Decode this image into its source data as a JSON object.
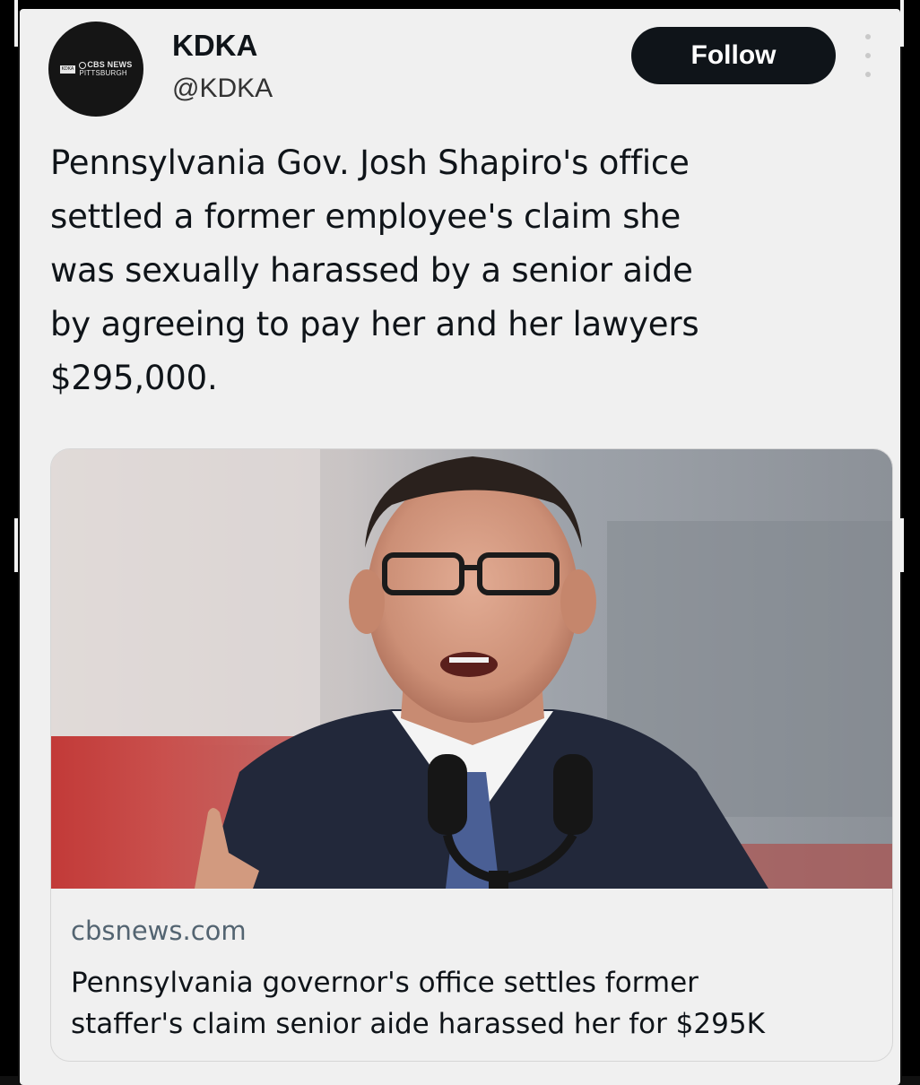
{
  "account": {
    "name": "KDKA",
    "handle": "@KDKA",
    "avatar_logo_box": "KDKA",
    "avatar_logo_line1": "CBS NEWS",
    "avatar_logo_line2": "PITTSBURGH"
  },
  "actions": {
    "follow_label": "Follow",
    "more_icon": "more-vertical-icon"
  },
  "tweet": {
    "text": "Pennsylvania Gov. Josh Shapiro's office\nsettled a former employee's claim she\nwas sexually harassed by a senior aide\nby agreeing to pay her and her lawyers\n$295,000."
  },
  "link_card": {
    "domain": "cbsnews.com",
    "headline": "Pennsylvania governor's office settles former\nstaffer's claim senior aide harassed her for $295K"
  },
  "colors": {
    "background": "#f0f0f0",
    "text": "#0f1419",
    "secondary_text": "#536471",
    "follow_button": "#0f1419"
  }
}
